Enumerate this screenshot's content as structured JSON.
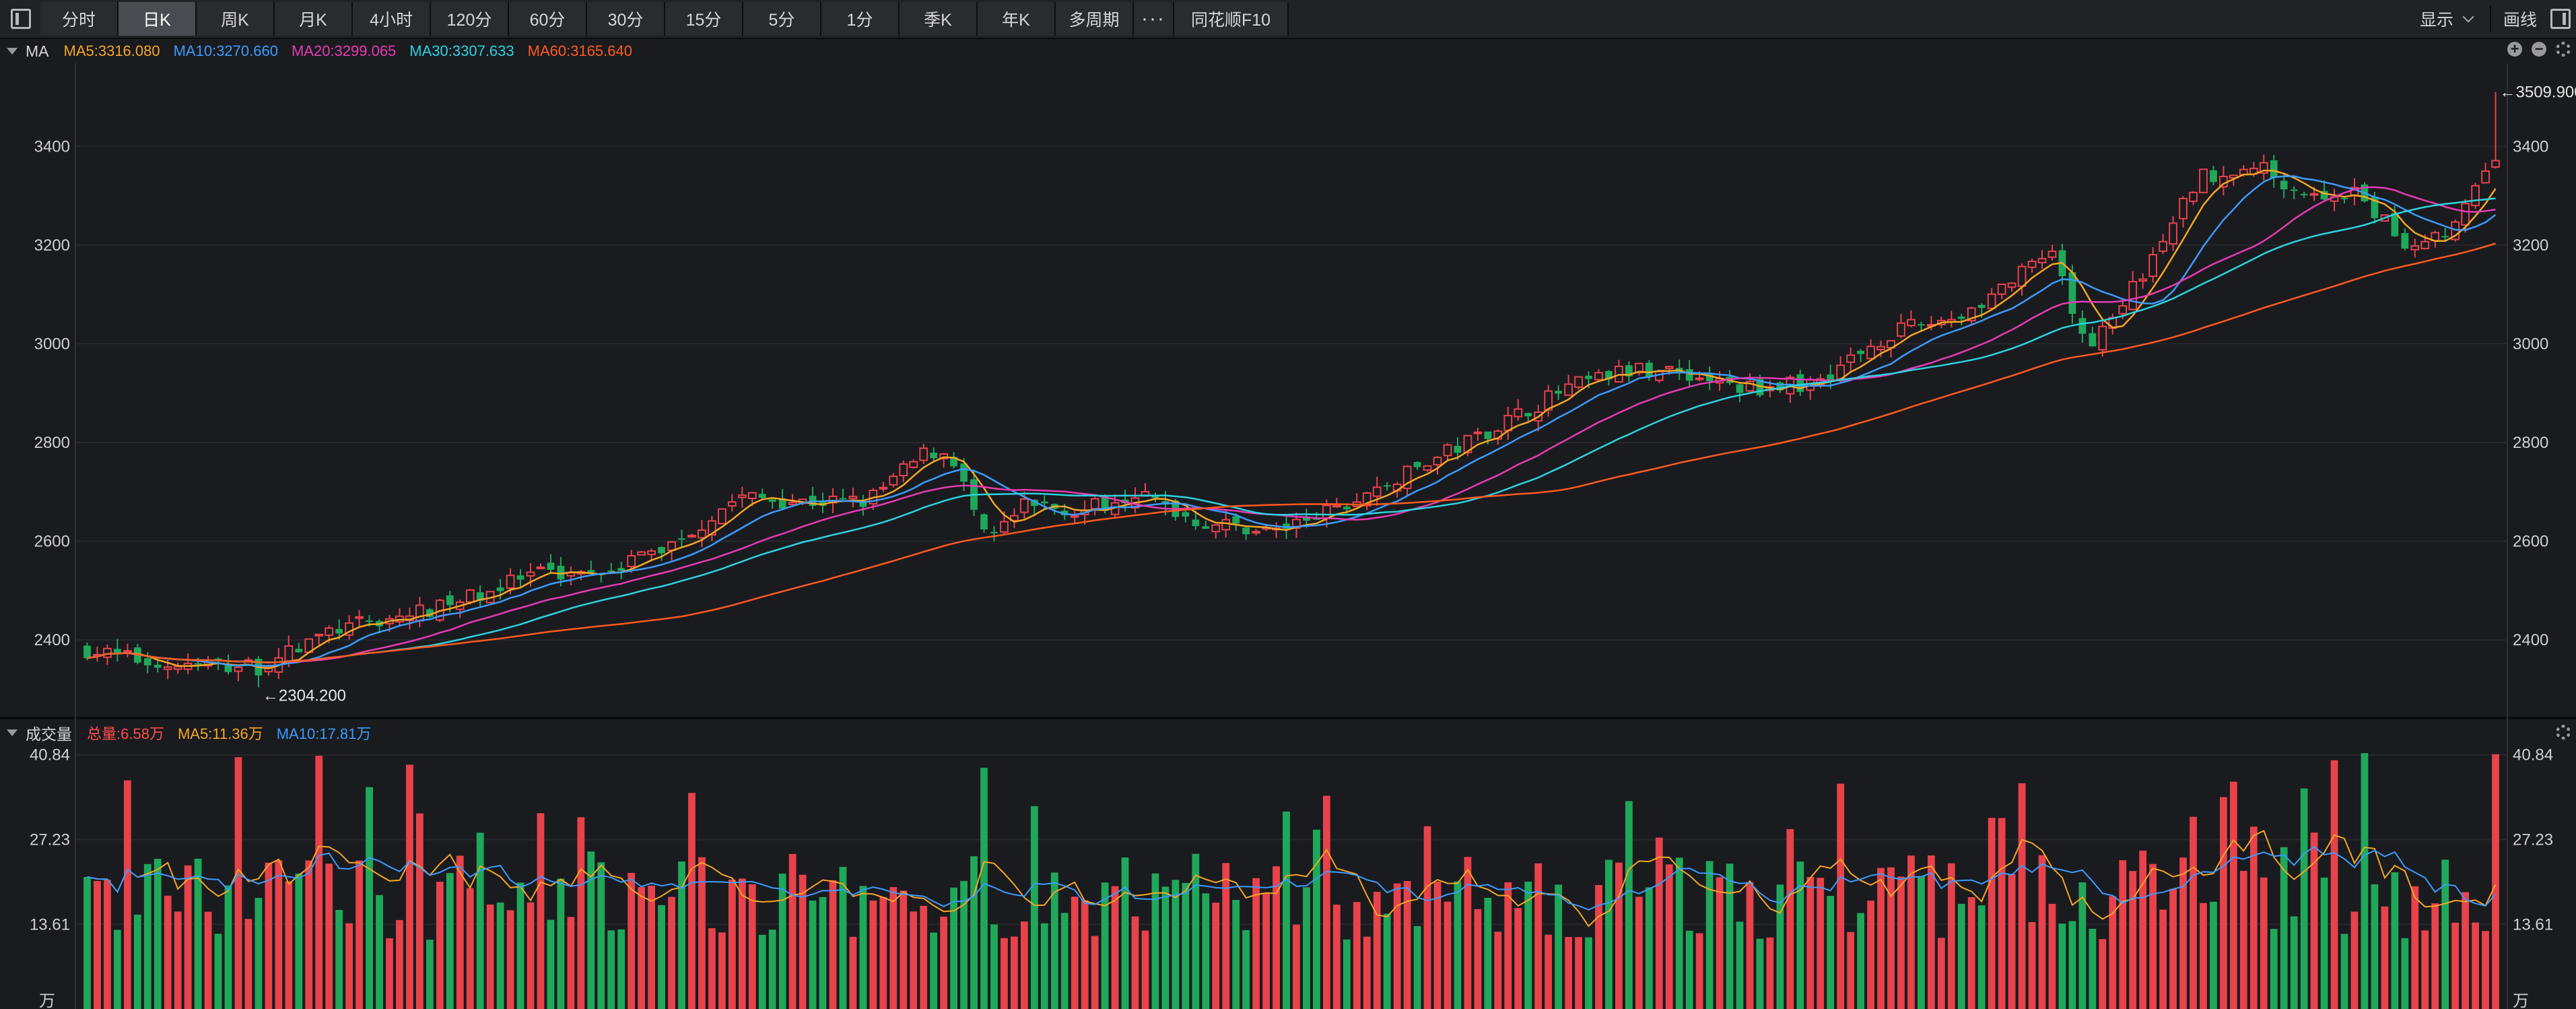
{
  "toolbar": {
    "tabs": [
      "分时",
      "日K",
      "周K",
      "月K",
      "4小时",
      "120分",
      "60分",
      "30分",
      "15分",
      "5分",
      "1分",
      "季K",
      "年K",
      "多周期",
      "···",
      "同花顺F10"
    ],
    "active_tab": "日K",
    "display_label": "显示",
    "draw_label": "画线"
  },
  "price_panel": {
    "indicator": "MA",
    "legend": [
      {
        "text": "MA5:3316.080",
        "color": "#f5a623"
      },
      {
        "text": "MA10:3270.660",
        "color": "#3b9cff"
      },
      {
        "text": "MA20:3299.065",
        "color": "#e83ab5"
      },
      {
        "text": "MA30:3307.633",
        "color": "#2bd3e0"
      },
      {
        "text": "MA60:3165.640",
        "color": "#ff5a1f"
      }
    ],
    "high_marker": "←3509.900",
    "low_marker": "←2304.200"
  },
  "volume_panel": {
    "indicator": "成交量",
    "legend": [
      {
        "text": "总量:6.58万",
        "color": "#ff4d4d"
      },
      {
        "text": "MA5:11.36万",
        "color": "#f5a623"
      },
      {
        "text": "MA10:17.81万",
        "color": "#3b9cff"
      }
    ],
    "unit": "万"
  },
  "colors": {
    "up": "#e8424b",
    "down": "#1fa85a",
    "grid": "#26282d",
    "axis_text": "#d0d0d0"
  },
  "chart_data": [
    {
      "type": "candlestick",
      "series_label": "MA",
      "y_ticks": [
        2400,
        2600,
        2800,
        3000,
        3200,
        3400
      ],
      "ylim": [
        2250,
        3560
      ],
      "candles": 240,
      "high": 3509.9,
      "low": 2304.2,
      "trend_anchors": [
        [
          0,
          2380
        ],
        [
          15,
          2350
        ],
        [
          35,
          2345
        ],
        [
          50,
          2420
        ],
        [
          70,
          2460
        ],
        [
          90,
          2530
        ],
        [
          105,
          2545
        ],
        [
          118,
          2590
        ],
        [
          132,
          2690
        ],
        [
          145,
          2680
        ],
        [
          158,
          2680
        ],
        [
          170,
          2780
        ],
        [
          175,
          2780
        ],
        [
          182,
          2600
        ],
        [
          190,
          2670
        ],
        [
          203,
          2665
        ],
        [
          212,
          2700
        ],
        [
          225,
          2640
        ],
        [
          240,
          2620
        ],
        [
          255,
          2670
        ],
        [
          270,
          2750
        ],
        [
          285,
          2830
        ],
        [
          300,
          2910
        ],
        [
          310,
          2940
        ],
        [
          320,
          2950
        ],
        [
          335,
          2910
        ],
        [
          350,
          2920
        ],
        [
          365,
          3020
        ],
        [
          380,
          3060
        ],
        [
          392,
          3140
        ],
        [
          398,
          3180
        ],
        [
          405,
          2990
        ],
        [
          418,
          3160
        ],
        [
          428,
          3340
        ],
        [
          440,
          3360
        ],
        [
          450,
          3300
        ],
        [
          460,
          3300
        ],
        [
          470,
          3200
        ],
        [
          480,
          3240
        ],
        [
          488,
          3380
        ]
      ],
      "ma_last": {
        "MA5": 3316.08,
        "MA10": 3270.66,
        "MA20": 3299.065,
        "MA30": 3307.633,
        "MA60": 3165.64
      }
    },
    {
      "type": "bar",
      "series_label": "成交量",
      "y_ticks": [
        13.61,
        27.23,
        40.84
      ],
      "unit": "万",
      "ylim": [
        0,
        42
      ]
    }
  ]
}
